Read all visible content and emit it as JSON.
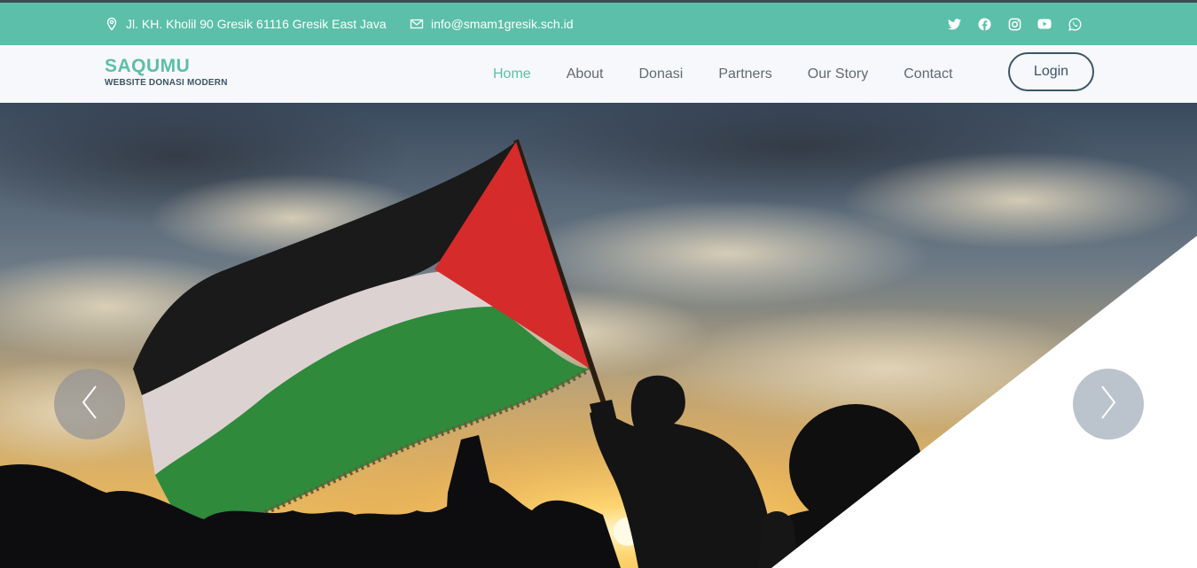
{
  "topbar": {
    "address": "Jl. KH. Kholil 90 Gresik 61116 Gresik East Java",
    "email": "info@smam1gresik.sch.id",
    "social": [
      "twitter-icon",
      "facebook-icon",
      "instagram-icon",
      "youtube-icon",
      "whatsapp-icon"
    ]
  },
  "brand": {
    "title": "SAQUMU",
    "subtitle": "WEBSITE DONASI MODERN"
  },
  "nav": {
    "items": [
      {
        "label": "Home",
        "active": true
      },
      {
        "label": "About",
        "active": false
      },
      {
        "label": "Donasi",
        "active": false
      },
      {
        "label": "Partners",
        "active": false
      },
      {
        "label": "Our Story",
        "active": false
      },
      {
        "label": "Contact",
        "active": false
      }
    ],
    "login_label": "Login"
  },
  "hero": {
    "image": "Palestinian flag waved against sunset sky",
    "prev_icon": "chevron-left-icon",
    "next_icon": "chevron-right-icon"
  },
  "colors": {
    "accent": "#5bbfa9",
    "brand_dark": "#3b5566",
    "topbar_border": "#3e4a52",
    "nav_bg": "#f7f8fb"
  }
}
